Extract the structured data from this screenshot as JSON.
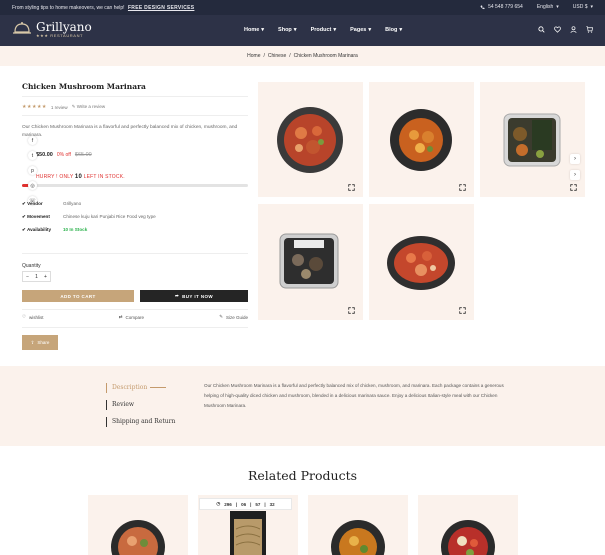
{
  "topbar": {
    "promo": "From styling tips to home makeovers, we can help!",
    "promo_link": "FREE DESIGN SERVICES",
    "phone": "54 548 779 654",
    "language": "English",
    "currency": "USD $"
  },
  "nav": {
    "logo": "Grillyano",
    "logo_sub": "RESTAURANT",
    "menu": [
      "Home",
      "Shop",
      "Product",
      "Pages",
      "Blog"
    ]
  },
  "breadcrumb": {
    "home": "Home",
    "category": "Chinese",
    "current": "Chicken Mushroom Marinara"
  },
  "product": {
    "title": "Chicken Mushroom Marinara",
    "rating": 5,
    "stars": "★★★★★",
    "review_count": "1 review",
    "write_review": "Write a review",
    "description": "Our Chicken Mushroom Marinara is a flavorful and perfectly balanced mix of chicken, mushroom, and marinara.",
    "price": "$50.00",
    "discount": "0% off",
    "old_price": "$65.00",
    "stock_prefix": "HURRY ! ONLY",
    "stock_count": "10",
    "stock_suffix": "LEFT IN STOCK.",
    "stock_level": 0.03,
    "specs": [
      {
        "key": "Vendor",
        "value": "Grillyano"
      },
      {
        "key": "Movement",
        "value": "Chinese kuju kari Punjabi Rice Food veg type"
      },
      {
        "key": "Availability",
        "value": "10 In Stock"
      }
    ],
    "quantity_label": "Quantity",
    "quantity": "1",
    "minus": "−",
    "plus": "+",
    "add_to_cart": "ADD TO CART",
    "buy_now": "BUY IT NOW",
    "wishlist": "wishlist",
    "compare": "Compare",
    "size_guide": "Size Guide",
    "share": "Share"
  },
  "tabs": {
    "items": [
      "Description",
      "Review",
      "Shipping and Return"
    ],
    "description_text": "Our Chicken Mushroom Marinara is a flavorful and perfectly balanced mix of chicken, mushroom, and marinara. Each package contains a generous helping of high-quality diced chicken and mushroom, blended in a delicious marinara sauce. Enjoy a delicious Italian-style meal with our Chicken Mushroom Marinara."
  },
  "related": {
    "title": "Related Products",
    "countdown": [
      "296",
      "06",
      "57",
      "32"
    ]
  },
  "colors": {
    "accent": "#c6a57a",
    "header_bg": "#2d3247",
    "sale_red": "#e0312f",
    "in_stock_green": "#2bb24c",
    "tile_bg": "#fbf2ec"
  }
}
